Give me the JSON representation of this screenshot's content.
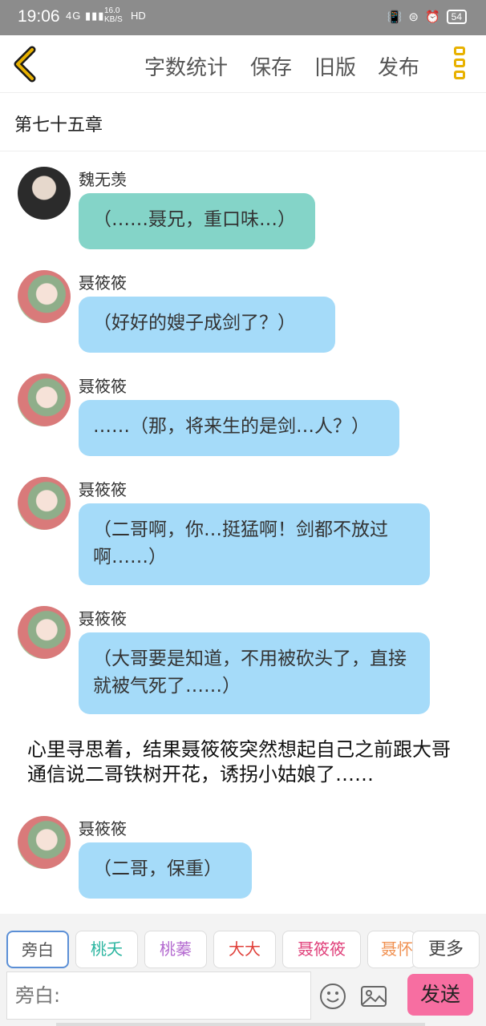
{
  "status_bar": {
    "time": "19:06",
    "signal": "4G",
    "speed_top": "16.0",
    "speed_unit": "KB/S",
    "hd": "HD",
    "battery": "54"
  },
  "toolbar": {
    "word_count_label": "字数统计",
    "save_label": "保存",
    "old_version_label": "旧版",
    "publish_label": "发布",
    "accent_color": "#e8b100"
  },
  "chapter": {
    "title": "第七十五章"
  },
  "messages": [
    {
      "sender": "魏无羡",
      "text": "（……聂兄，重口味…）",
      "color": "#84d4c8"
    },
    {
      "sender": "聂筱筱",
      "text": "（好好的嫂子成剑了？）",
      "color": "#a5dbf9"
    },
    {
      "sender": "聂筱筱",
      "text": "……（那，将来生的是剑…人？）",
      "color": "#a5dbf9"
    },
    {
      "sender": "聂筱筱",
      "text": "（二哥啊，你…挺猛啊！剑都不放过啊……）",
      "color": "#a5dbf9"
    },
    {
      "sender": "聂筱筱",
      "text": "（大哥要是知道，不用被砍头了，直接就被气死了……）",
      "color": "#a5dbf9"
    },
    {
      "sender": "聂筱筱",
      "text": "（二哥，保重）",
      "color": "#a5dbf9"
    }
  ],
  "narration": "心里寻思着，结果聂筱筱突然想起自己之前跟大哥通信说二哥铁树开花，诱拐小姑娘了……",
  "roles": [
    {
      "label": "旁白",
      "color": "#555555"
    },
    {
      "label": "桃夭",
      "color": "#2bb5a0"
    },
    {
      "label": "桃蓁",
      "color": "#b46ad0"
    },
    {
      "label": "大大",
      "color": "#e0403a"
    },
    {
      "label": "聂筱筱",
      "color": "#e0407a"
    },
    {
      "label": "聂怀",
      "color": "#f09050"
    }
  ],
  "more_roles_label": "更多",
  "input": {
    "placeholder": "旁白:"
  },
  "send_label": "发送",
  "send_color": "#f76ea1"
}
